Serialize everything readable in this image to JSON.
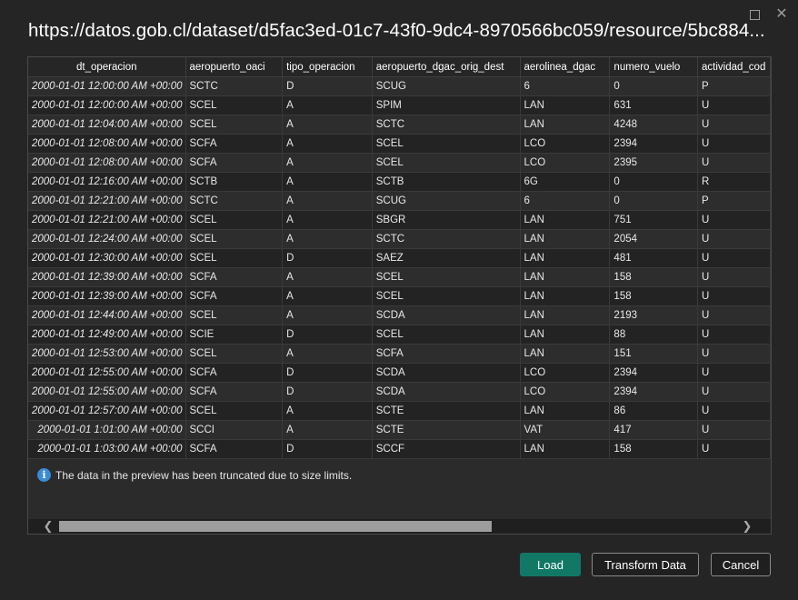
{
  "dialog": {
    "title": "https://datos.gob.cl/dataset/d5fac3ed-01c7-43f0-9dc4-8970566bc059/resource/5bc884...",
    "maximize_glyph": "□",
    "close_glyph": "✕"
  },
  "table": {
    "columns": [
      "dt_operacion",
      "aeropuerto_oaci",
      "tipo_operacion",
      "aeropuerto_dgac_orig_dest",
      "aerolinea_dgac",
      "numero_vuelo",
      "actividad_cod"
    ],
    "rows": [
      [
        "2000-01-01 12:00:00 AM +00:00",
        "SCTC",
        "D",
        "SCUG",
        "6",
        "0",
        "P"
      ],
      [
        "2000-01-01 12:00:00 AM +00:00",
        "SCEL",
        "A",
        "SPIM",
        "LAN",
        "631",
        "U"
      ],
      [
        "2000-01-01 12:04:00 AM +00:00",
        "SCEL",
        "A",
        "SCTC",
        "LAN",
        "4248",
        "U"
      ],
      [
        "2000-01-01 12:08:00 AM +00:00",
        "SCFA",
        "A",
        "SCEL",
        "LCO",
        "2394",
        "U"
      ],
      [
        "2000-01-01 12:08:00 AM +00:00",
        "SCFA",
        "A",
        "SCEL",
        "LCO",
        "2395",
        "U"
      ],
      [
        "2000-01-01 12:16:00 AM +00:00",
        "SCTB",
        "A",
        "SCTB",
        "6G",
        "0",
        "R"
      ],
      [
        "2000-01-01 12:21:00 AM +00:00",
        "SCTC",
        "A",
        "SCUG",
        "6",
        "0",
        "P"
      ],
      [
        "2000-01-01 12:21:00 AM +00:00",
        "SCEL",
        "A",
        "SBGR",
        "LAN",
        "751",
        "U"
      ],
      [
        "2000-01-01 12:24:00 AM +00:00",
        "SCEL",
        "A",
        "SCTC",
        "LAN",
        "2054",
        "U"
      ],
      [
        "2000-01-01 12:30:00 AM +00:00",
        "SCEL",
        "D",
        "SAEZ",
        "LAN",
        "481",
        "U"
      ],
      [
        "2000-01-01 12:39:00 AM +00:00",
        "SCFA",
        "A",
        "SCEL",
        "LAN",
        "158",
        "U"
      ],
      [
        "2000-01-01 12:39:00 AM +00:00",
        "SCFA",
        "A",
        "SCEL",
        "LAN",
        "158",
        "U"
      ],
      [
        "2000-01-01 12:44:00 AM +00:00",
        "SCEL",
        "A",
        "SCDA",
        "LAN",
        "2193",
        "U"
      ],
      [
        "2000-01-01 12:49:00 AM +00:00",
        "SCIE",
        "D",
        "SCEL",
        "LAN",
        "88",
        "U"
      ],
      [
        "2000-01-01 12:53:00 AM +00:00",
        "SCEL",
        "A",
        "SCFA",
        "LAN",
        "151",
        "U"
      ],
      [
        "2000-01-01 12:55:00 AM +00:00",
        "SCFA",
        "D",
        "SCDA",
        "LCO",
        "2394",
        "U"
      ],
      [
        "2000-01-01 12:55:00 AM +00:00",
        "SCFA",
        "D",
        "SCDA",
        "LCO",
        "2394",
        "U"
      ],
      [
        "2000-01-01 12:57:00 AM +00:00",
        "SCEL",
        "A",
        "SCTE",
        "LAN",
        "86",
        "U"
      ],
      [
        "2000-01-01 1:01:00 AM +00:00",
        "SCCI",
        "A",
        "SCTE",
        "VAT",
        "417",
        "U"
      ],
      [
        "2000-01-01 1:03:00 AM +00:00",
        "SCFA",
        "D",
        "SCCF",
        "LAN",
        "158",
        "U"
      ]
    ]
  },
  "notice": {
    "icon": "info-icon",
    "icon_glyph": "i",
    "text": "The data in the preview has been truncated due to size limits."
  },
  "scrollbar": {
    "left_glyph": "❮",
    "right_glyph": "❯"
  },
  "buttons": {
    "load": "Load",
    "transform": "Transform Data",
    "cancel": "Cancel"
  },
  "colors": {
    "background": "#252526",
    "primary_button": "#117865",
    "info_icon": "#3a8ad6"
  }
}
